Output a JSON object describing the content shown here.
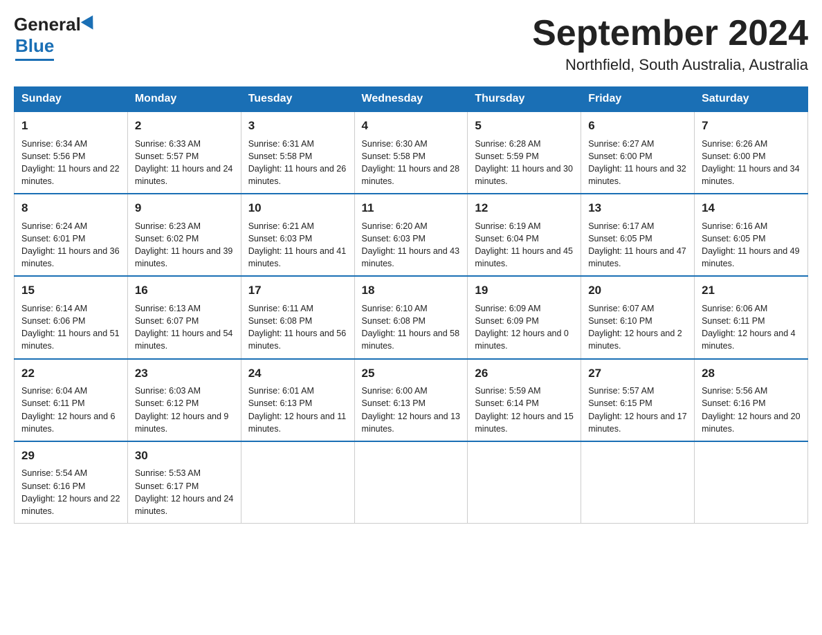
{
  "header": {
    "logo_general": "General",
    "logo_blue": "Blue",
    "month_title": "September 2024",
    "location": "Northfield, South Australia, Australia"
  },
  "days_of_week": [
    "Sunday",
    "Monday",
    "Tuesday",
    "Wednesday",
    "Thursday",
    "Friday",
    "Saturday"
  ],
  "weeks": [
    [
      {
        "num": "1",
        "sunrise": "6:34 AM",
        "sunset": "5:56 PM",
        "daylight": "11 hours and 22 minutes."
      },
      {
        "num": "2",
        "sunrise": "6:33 AM",
        "sunset": "5:57 PM",
        "daylight": "11 hours and 24 minutes."
      },
      {
        "num": "3",
        "sunrise": "6:31 AM",
        "sunset": "5:58 PM",
        "daylight": "11 hours and 26 minutes."
      },
      {
        "num": "4",
        "sunrise": "6:30 AM",
        "sunset": "5:58 PM",
        "daylight": "11 hours and 28 minutes."
      },
      {
        "num": "5",
        "sunrise": "6:28 AM",
        "sunset": "5:59 PM",
        "daylight": "11 hours and 30 minutes."
      },
      {
        "num": "6",
        "sunrise": "6:27 AM",
        "sunset": "6:00 PM",
        "daylight": "11 hours and 32 minutes."
      },
      {
        "num": "7",
        "sunrise": "6:26 AM",
        "sunset": "6:00 PM",
        "daylight": "11 hours and 34 minutes."
      }
    ],
    [
      {
        "num": "8",
        "sunrise": "6:24 AM",
        "sunset": "6:01 PM",
        "daylight": "11 hours and 36 minutes."
      },
      {
        "num": "9",
        "sunrise": "6:23 AM",
        "sunset": "6:02 PM",
        "daylight": "11 hours and 39 minutes."
      },
      {
        "num": "10",
        "sunrise": "6:21 AM",
        "sunset": "6:03 PM",
        "daylight": "11 hours and 41 minutes."
      },
      {
        "num": "11",
        "sunrise": "6:20 AM",
        "sunset": "6:03 PM",
        "daylight": "11 hours and 43 minutes."
      },
      {
        "num": "12",
        "sunrise": "6:19 AM",
        "sunset": "6:04 PM",
        "daylight": "11 hours and 45 minutes."
      },
      {
        "num": "13",
        "sunrise": "6:17 AM",
        "sunset": "6:05 PM",
        "daylight": "11 hours and 47 minutes."
      },
      {
        "num": "14",
        "sunrise": "6:16 AM",
        "sunset": "6:05 PM",
        "daylight": "11 hours and 49 minutes."
      }
    ],
    [
      {
        "num": "15",
        "sunrise": "6:14 AM",
        "sunset": "6:06 PM",
        "daylight": "11 hours and 51 minutes."
      },
      {
        "num": "16",
        "sunrise": "6:13 AM",
        "sunset": "6:07 PM",
        "daylight": "11 hours and 54 minutes."
      },
      {
        "num": "17",
        "sunrise": "6:11 AM",
        "sunset": "6:08 PM",
        "daylight": "11 hours and 56 minutes."
      },
      {
        "num": "18",
        "sunrise": "6:10 AM",
        "sunset": "6:08 PM",
        "daylight": "11 hours and 58 minutes."
      },
      {
        "num": "19",
        "sunrise": "6:09 AM",
        "sunset": "6:09 PM",
        "daylight": "12 hours and 0 minutes."
      },
      {
        "num": "20",
        "sunrise": "6:07 AM",
        "sunset": "6:10 PM",
        "daylight": "12 hours and 2 minutes."
      },
      {
        "num": "21",
        "sunrise": "6:06 AM",
        "sunset": "6:11 PM",
        "daylight": "12 hours and 4 minutes."
      }
    ],
    [
      {
        "num": "22",
        "sunrise": "6:04 AM",
        "sunset": "6:11 PM",
        "daylight": "12 hours and 6 minutes."
      },
      {
        "num": "23",
        "sunrise": "6:03 AM",
        "sunset": "6:12 PM",
        "daylight": "12 hours and 9 minutes."
      },
      {
        "num": "24",
        "sunrise": "6:01 AM",
        "sunset": "6:13 PM",
        "daylight": "12 hours and 11 minutes."
      },
      {
        "num": "25",
        "sunrise": "6:00 AM",
        "sunset": "6:13 PM",
        "daylight": "12 hours and 13 minutes."
      },
      {
        "num": "26",
        "sunrise": "5:59 AM",
        "sunset": "6:14 PM",
        "daylight": "12 hours and 15 minutes."
      },
      {
        "num": "27",
        "sunrise": "5:57 AM",
        "sunset": "6:15 PM",
        "daylight": "12 hours and 17 minutes."
      },
      {
        "num": "28",
        "sunrise": "5:56 AM",
        "sunset": "6:16 PM",
        "daylight": "12 hours and 20 minutes."
      }
    ],
    [
      {
        "num": "29",
        "sunrise": "5:54 AM",
        "sunset": "6:16 PM",
        "daylight": "12 hours and 22 minutes."
      },
      {
        "num": "30",
        "sunrise": "5:53 AM",
        "sunset": "6:17 PM",
        "daylight": "12 hours and 24 minutes."
      },
      null,
      null,
      null,
      null,
      null
    ]
  ],
  "labels": {
    "sunrise": "Sunrise:",
    "sunset": "Sunset:",
    "daylight": "Daylight:"
  }
}
